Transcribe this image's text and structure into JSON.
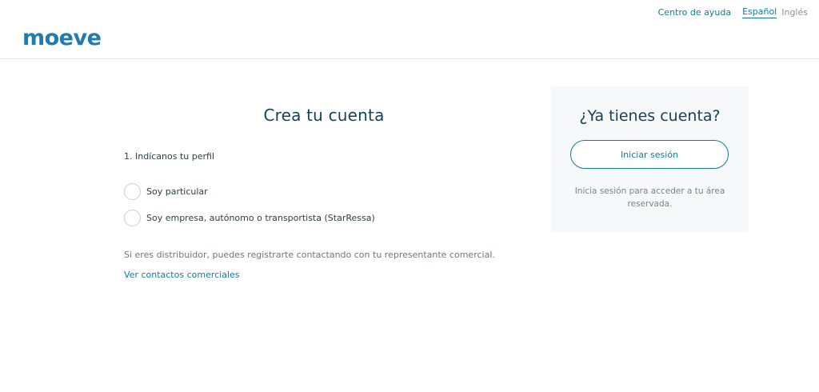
{
  "header": {
    "brand": "moeve",
    "help_link": "Centro de ayuda",
    "languages": {
      "active": "Español",
      "other": "Inglés"
    }
  },
  "create_account": {
    "title": "Crea tu cuenta",
    "step_label": "1. Indícanos tu perfil",
    "options": [
      {
        "label": "Soy particular"
      },
      {
        "label": "Soy empresa, autónomo o transportista (StarRessa)"
      }
    ],
    "distributor_note": "Si eres distribuidor, puedes registrarte contactando con tu representante comercial.",
    "contacts_link": "Ver contactos comerciales"
  },
  "login_card": {
    "title": "¿Ya tienes cuenta?",
    "button_label": "Iniciar sesión",
    "note": "Inicia sesión para acceder a tu área reservada."
  },
  "colors": {
    "brand": "#0f7d9a",
    "heading": "#174455",
    "card_bg": "#f7f8f9"
  },
  "icons": {
    "logo": "moeve-logo"
  }
}
